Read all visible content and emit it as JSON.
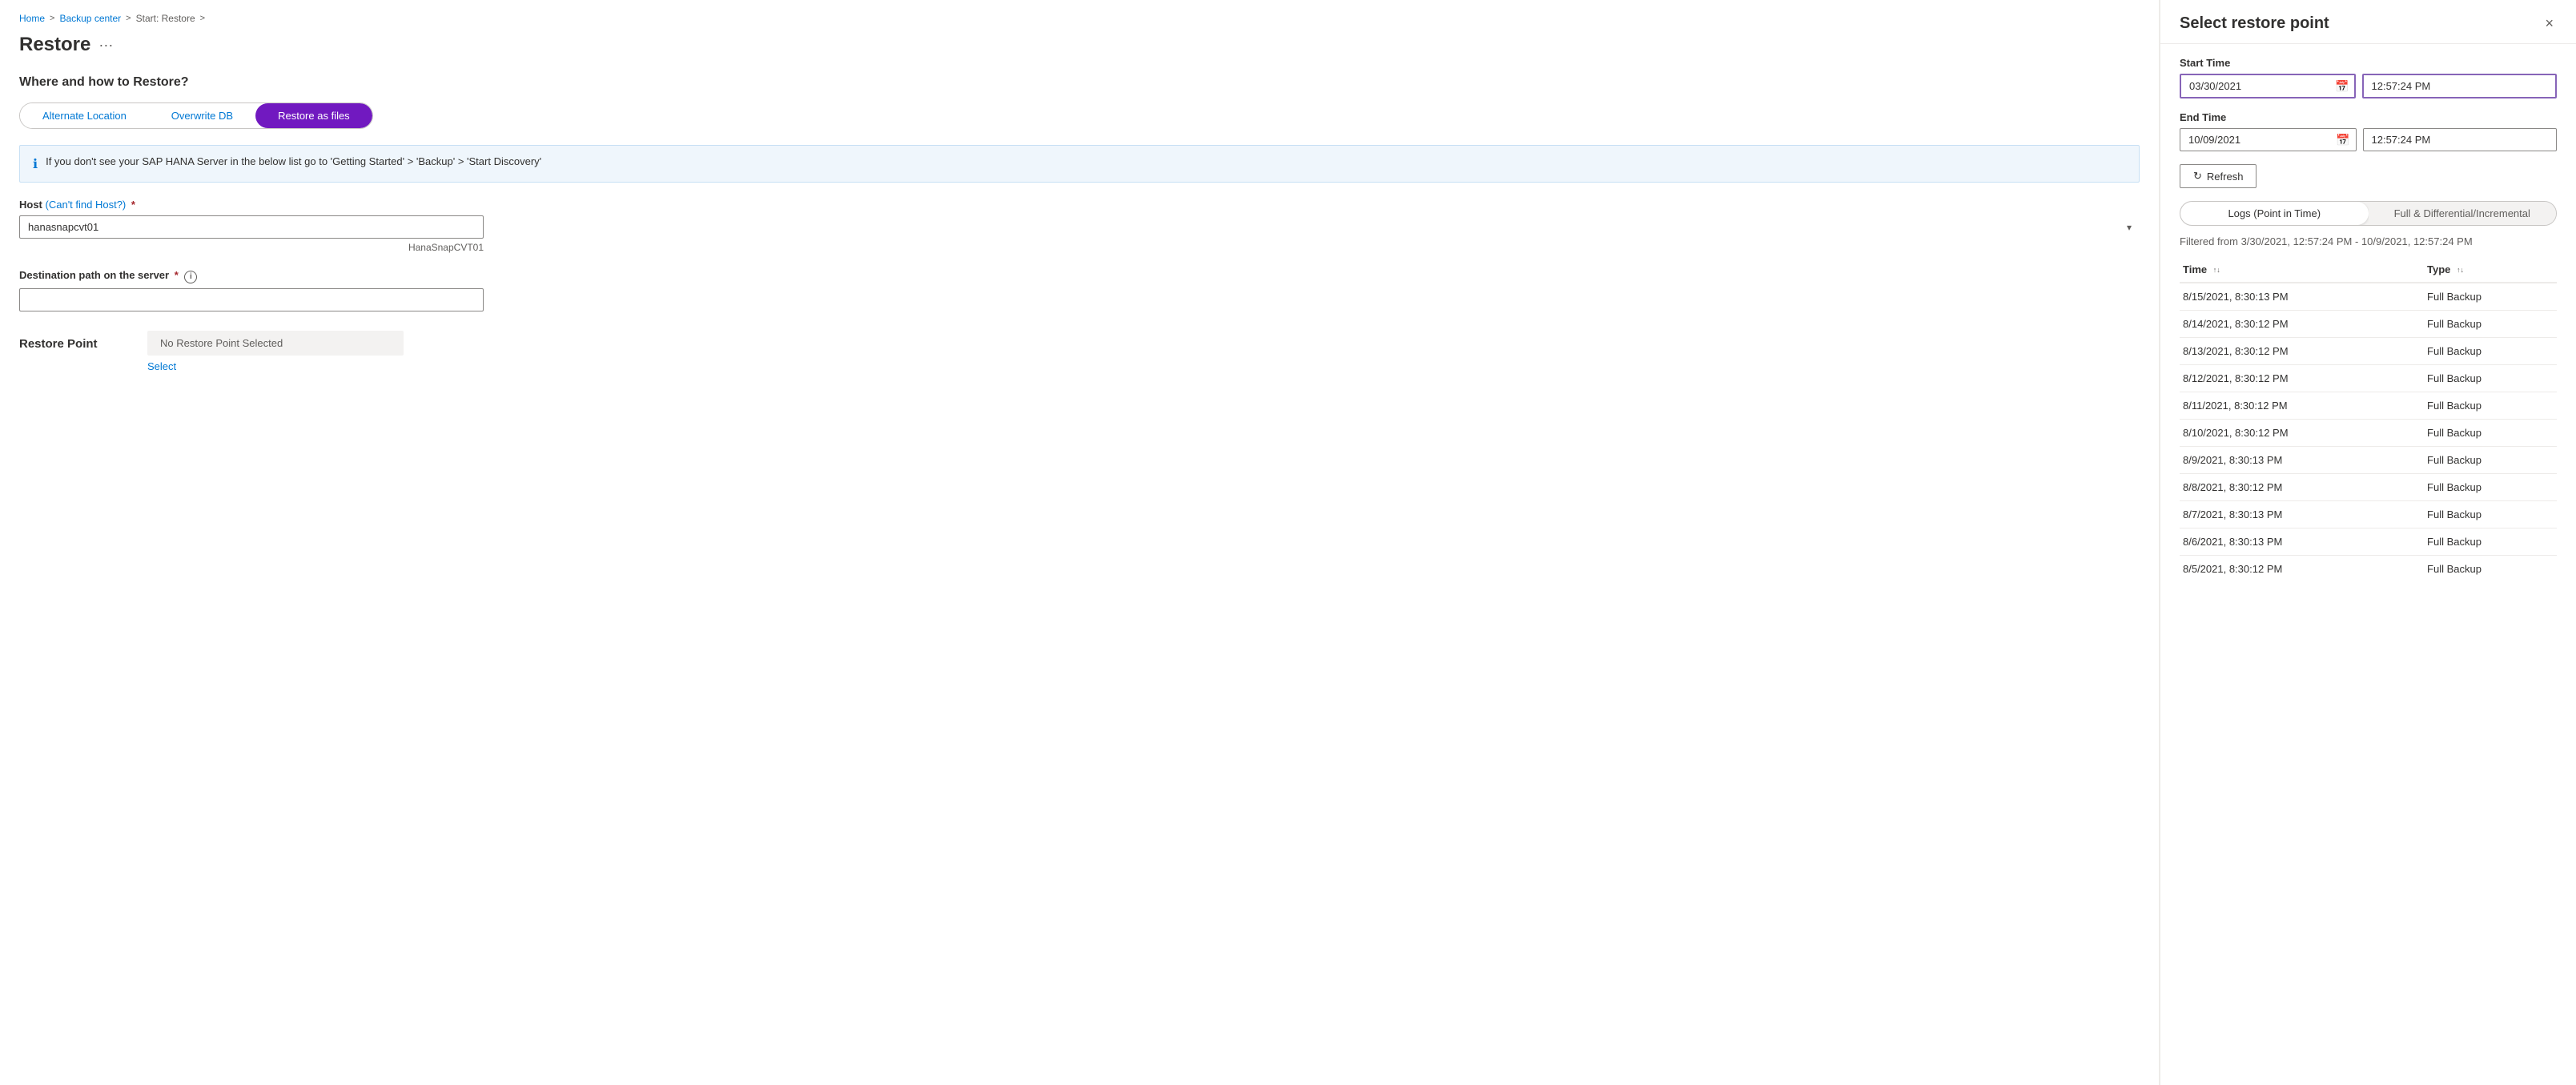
{
  "breadcrumb": {
    "home": "Home",
    "backup_center": "Backup center",
    "current": "Start: Restore",
    "sep": ">"
  },
  "page": {
    "title": "Restore",
    "ellipsis": "···",
    "section_title": "Where and how to Restore?"
  },
  "tabs": [
    {
      "id": "alternate",
      "label": "Alternate Location",
      "active": false
    },
    {
      "id": "overwrite",
      "label": "Overwrite DB",
      "active": false
    },
    {
      "id": "restore_files",
      "label": "Restore as files",
      "active": true
    }
  ],
  "info_box": {
    "text": "If you don't see your SAP HANA Server in the below list go to 'Getting Started' > 'Backup' > 'Start Discovery'"
  },
  "host_field": {
    "label": "Host",
    "link_label": "(Can't find Host?)",
    "required": true,
    "value": "hanasnapcvt01",
    "hint": "HanaSnapCVT01",
    "options": [
      "hanasnapcvt01"
    ]
  },
  "destination_field": {
    "label": "Destination path on the server",
    "required": true,
    "value": "",
    "placeholder": ""
  },
  "restore_point": {
    "label": "Restore Point",
    "placeholder_text": "No Restore Point Selected",
    "select_label": "Select"
  },
  "right_panel": {
    "title": "Select restore point",
    "close_label": "×",
    "start_time_label": "Start Time",
    "start_date": "03/30/2021",
    "start_time": "12:57:24 PM",
    "end_time_label": "End Time",
    "end_date": "10/09/2021",
    "end_time": "12:57:24 PM",
    "refresh_label": "Refresh",
    "toggle_logs": "Logs (Point in Time)",
    "toggle_full": "Full & Differential/Incremental",
    "filter_text": "Filtered from 3/30/2021, 12:57:24 PM - 10/9/2021, 12:57:24 PM",
    "table_headers": [
      {
        "id": "time",
        "label": "Time",
        "sortable": true
      },
      {
        "id": "type",
        "label": "Type",
        "sortable": true
      }
    ],
    "table_rows": [
      {
        "time": "8/15/2021, 8:30:13 PM",
        "type": "Full Backup"
      },
      {
        "time": "8/14/2021, 8:30:12 PM",
        "type": "Full Backup"
      },
      {
        "time": "8/13/2021, 8:30:12 PM",
        "type": "Full Backup"
      },
      {
        "time": "8/12/2021, 8:30:12 PM",
        "type": "Full Backup"
      },
      {
        "time": "8/11/2021, 8:30:12 PM",
        "type": "Full Backup"
      },
      {
        "time": "8/10/2021, 8:30:12 PM",
        "type": "Full Backup"
      },
      {
        "time": "8/9/2021, 8:30:13 PM",
        "type": "Full Backup"
      },
      {
        "time": "8/8/2021, 8:30:12 PM",
        "type": "Full Backup"
      },
      {
        "time": "8/7/2021, 8:30:13 PM",
        "type": "Full Backup"
      },
      {
        "time": "8/6/2021, 8:30:13 PM",
        "type": "Full Backup"
      },
      {
        "time": "8/5/2021, 8:30:12 PM",
        "type": "Full Backup"
      }
    ]
  }
}
